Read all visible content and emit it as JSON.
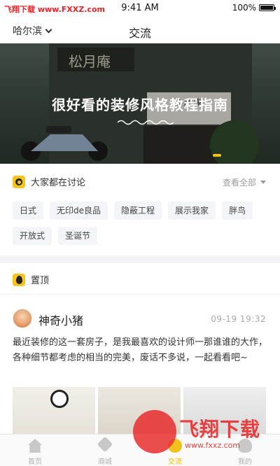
{
  "status_bar": {
    "watermark": "飞翔下载 www.FXXZ.com",
    "time": "9:41 AM",
    "battery": "100%"
  },
  "nav": {
    "city": "哈尔滨",
    "title": "交流"
  },
  "banner": {
    "headline": "很好看的装修风格教程指南",
    "sign_text": "松月庵",
    "curtain_text": "松 月 庵"
  },
  "discussion": {
    "title": "大家都在讨论",
    "see_all": "查看全部",
    "tags": [
      "日式",
      "无印de良品",
      "隐蔽工程",
      "展示我家",
      "胖鸟",
      "开放式",
      "圣诞节"
    ]
  },
  "pinned": {
    "title": "置顶"
  },
  "post": {
    "author": "神奇小猪",
    "date": "09-19  19:32",
    "text": "最近装修的这一套房子，是我最喜欢的设计师一那谁谁的大作，各种细节都考虑的相当的完美，废话不多说，一起看看吧~"
  },
  "tabbar": {
    "items": [
      {
        "label": "首页",
        "icon": "home-icon"
      },
      {
        "label": "商城",
        "icon": "tag-icon"
      },
      {
        "label": "交流",
        "icon": "chat-icon"
      },
      {
        "label": "我的",
        "icon": "profile-icon"
      }
    ]
  },
  "watermark_br": {
    "big": "飞翔下载",
    "url": "www.fxxz.com"
  },
  "colors": {
    "accent": "#f6c51b",
    "watermark": "#e72d2d"
  }
}
